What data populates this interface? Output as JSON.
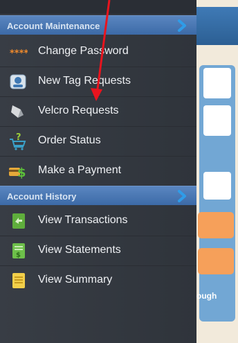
{
  "maintenance_section": {
    "title": "Account Maintenance"
  },
  "maintenance_items": [
    {
      "label": "Change Password"
    },
    {
      "label": "New Tag Requests"
    },
    {
      "label": "Velcro Requests"
    },
    {
      "label": "Order Status"
    },
    {
      "label": "Make a Payment"
    }
  ],
  "history_section": {
    "title": "Account History"
  },
  "history_items": [
    {
      "label": "View Transactions"
    },
    {
      "label": "View Statements"
    },
    {
      "label": "View Summary"
    }
  ],
  "background_app": {
    "partial_text": "ough"
  },
  "colors": {
    "annotation_arrow": "#e8141e",
    "section_header": "#4a78b4",
    "drawer": "#353a41"
  }
}
